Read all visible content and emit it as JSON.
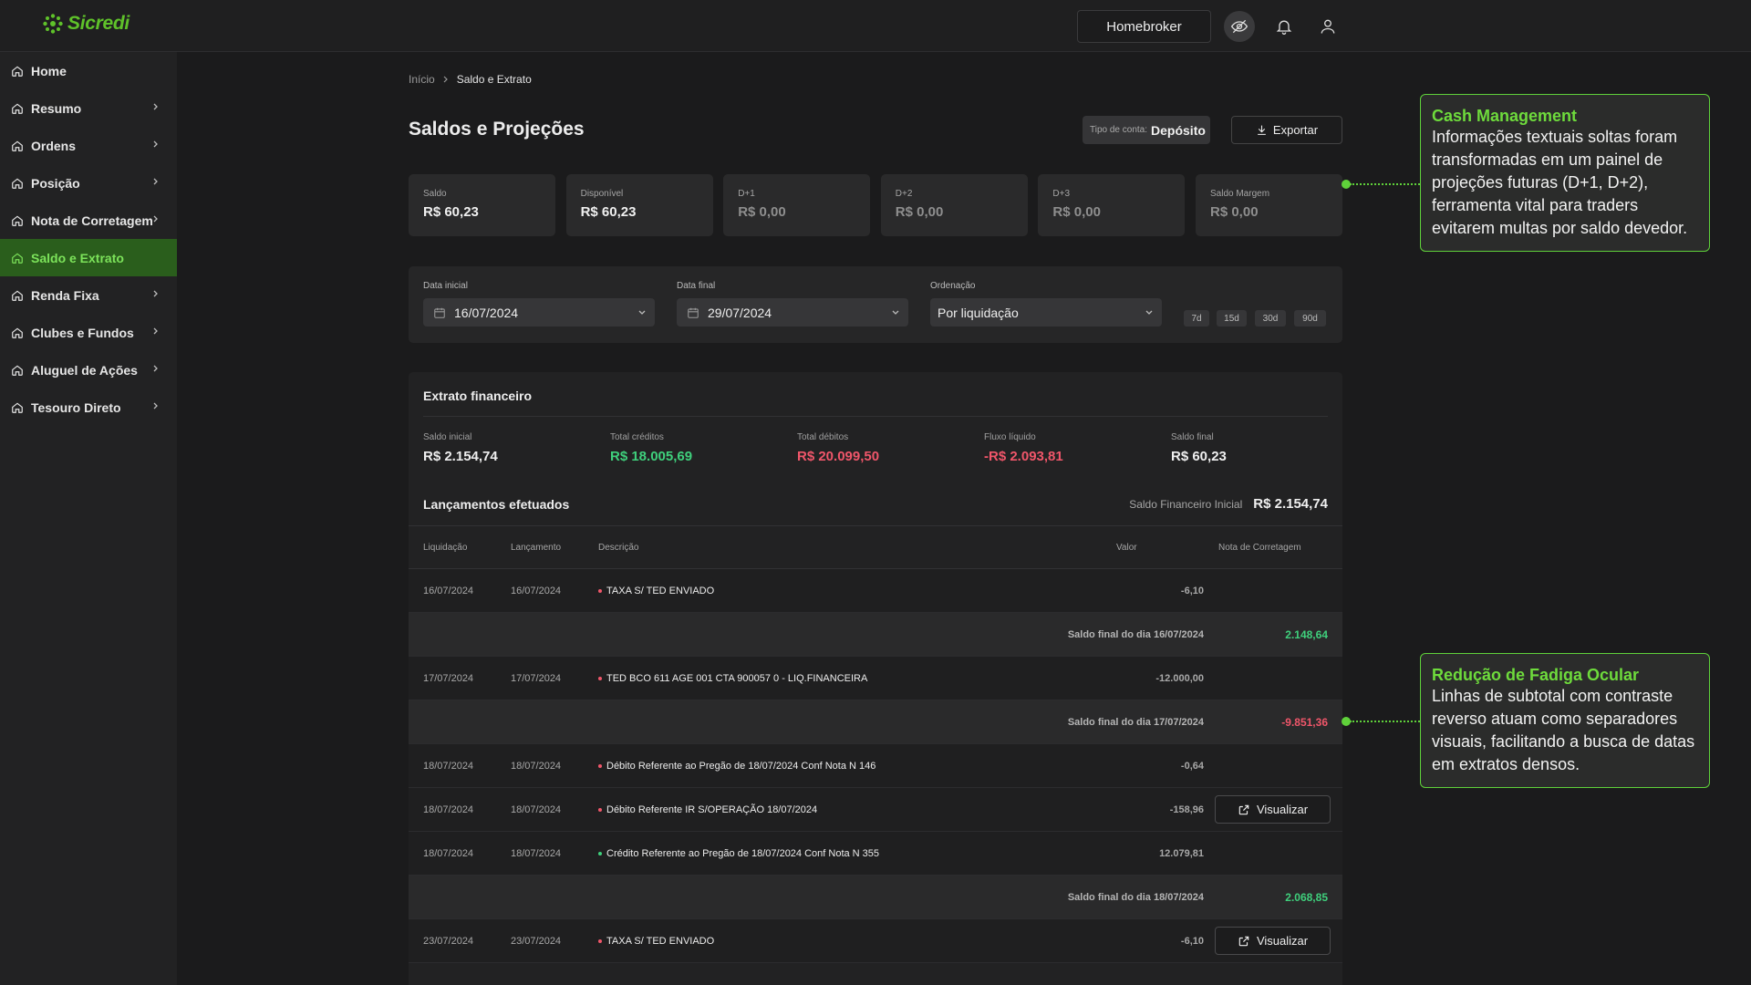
{
  "brand": {
    "name": "Sicredi",
    "accent": "#5fc22a"
  },
  "header": {
    "homebroker_label": "Homebroker",
    "icons": [
      "eye-off-icon",
      "bell-icon",
      "user-icon"
    ]
  },
  "sidebar": {
    "items": [
      {
        "label": "Home",
        "chevron": false,
        "active": false
      },
      {
        "label": "Resumo",
        "chevron": true,
        "active": false
      },
      {
        "label": "Ordens",
        "chevron": true,
        "active": false
      },
      {
        "label": "Posição",
        "chevron": true,
        "active": false
      },
      {
        "label": "Nota de Corretagem",
        "chevron": true,
        "active": false
      },
      {
        "label": "Saldo e Extrato",
        "chevron": false,
        "active": true
      },
      {
        "label": "Renda Fixa",
        "chevron": true,
        "active": false
      },
      {
        "label": "Clubes e Fundos",
        "chevron": true,
        "active": false
      },
      {
        "label": "Aluguel de Ações",
        "chevron": true,
        "active": false
      },
      {
        "label": "Tesouro Direto",
        "chevron": true,
        "active": false
      }
    ]
  },
  "breadcrumb": {
    "root": "Início",
    "current": "Saldo e Extrato"
  },
  "page": {
    "title": "Saldos e Projeções",
    "account_type_label": "Tipo de conta:",
    "account_type_value": "Depósito",
    "export_label": "Exportar"
  },
  "balances": [
    {
      "label": "Saldo",
      "value": "R$ 60,23"
    },
    {
      "label": "Disponível",
      "value": "R$ 60,23"
    },
    {
      "label": "D+1",
      "value": "R$ 0,00"
    },
    {
      "label": "D+2",
      "value": "R$ 0,00"
    },
    {
      "label": "D+3",
      "value": "R$ 0,00"
    },
    {
      "label": "Saldo Margem",
      "value": "R$ 0,00"
    }
  ],
  "filters": {
    "start_label": "Data inicial",
    "start_value": "16/07/2024",
    "end_label": "Data final",
    "end_value": "29/07/2024",
    "order_label": "Ordenação",
    "order_value": "Por liquidação",
    "quick_ranges": [
      "7d",
      "15d",
      "30d",
      "90d"
    ]
  },
  "statement": {
    "title": "Extrato financeiro",
    "summary": [
      {
        "label": "Saldo inicial",
        "value": "R$ 2.154,74",
        "tone": "white"
      },
      {
        "label": "Total créditos",
        "value": "R$ 18.005,69",
        "tone": "green"
      },
      {
        "label": "Total débitos",
        "value": "R$ 20.099,50",
        "tone": "red"
      },
      {
        "label": "Fluxo líquido",
        "value": "-R$ 2.093,81",
        "tone": "red"
      },
      {
        "label": "Saldo final",
        "value": "R$ 60,23",
        "tone": "white"
      }
    ],
    "entries_title": "Lançamentos efetuados",
    "initial_label": "Saldo Financeiro Inicial",
    "initial_value": "R$  2.154,74",
    "columns": [
      "Liquidação",
      "Lançamento",
      "Descrição",
      "Valor",
      "Nota de Corretagem"
    ],
    "view_label": "Visualizar",
    "rows": [
      {
        "type": "entry",
        "liq": "16/07/2024",
        "lanc": "16/07/2024",
        "desc": "TAXA S/ TED ENVIADO",
        "value": "-6,10",
        "tone": "red",
        "view": false
      },
      {
        "type": "subtotal",
        "label": "Saldo final do dia 16/07/2024",
        "value": "2.148,64",
        "tone": "green"
      },
      {
        "type": "entry",
        "liq": "17/07/2024",
        "lanc": "17/07/2024",
        "desc": "TED BCO 611 AGE 001 CTA 900057 0 - LIQ.FINANCEIRA",
        "value": "-12.000,00",
        "tone": "red",
        "view": false
      },
      {
        "type": "subtotal",
        "label": "Saldo final do dia 17/07/2024",
        "value": "-9.851,36",
        "tone": "red"
      },
      {
        "type": "entry",
        "liq": "18/07/2024",
        "lanc": "18/07/2024",
        "desc": "Débito Referente ao Pregão de 18/07/2024 Conf Nota N 146",
        "value": "-0,64",
        "tone": "red",
        "view": false
      },
      {
        "type": "entry",
        "liq": "18/07/2024",
        "lanc": "18/07/2024",
        "desc": "Débito Referente IR S/OPERAÇÃO 18/07/2024",
        "value": "-158,96",
        "tone": "red",
        "view": true
      },
      {
        "type": "entry",
        "liq": "18/07/2024",
        "lanc": "18/07/2024",
        "desc": "Crédito Referente ao Pregão de 18/07/2024 Conf Nota N 355",
        "value": "12.079,81",
        "tone": "green",
        "view": false
      },
      {
        "type": "subtotal",
        "label": "Saldo final do dia 18/07/2024",
        "value": "2.068,85",
        "tone": "green"
      },
      {
        "type": "entry",
        "liq": "23/07/2024",
        "lanc": "23/07/2024",
        "desc": "TAXA S/ TED ENVIADO",
        "value": "-6,10",
        "tone": "red",
        "view": true
      }
    ]
  },
  "callouts": [
    {
      "title": "Cash Management",
      "body": "Informações textuais soltas foram transformadas em um painel de projeções futuras (D+1, D+2), ferramenta vital para traders evitarem multas por saldo devedor."
    },
    {
      "title": "Redução de Fadiga Ocular",
      "body": "Linhas de subtotal com contraste reverso atuam como separadores visuais, facilitando a busca de datas em extratos densos."
    }
  ]
}
